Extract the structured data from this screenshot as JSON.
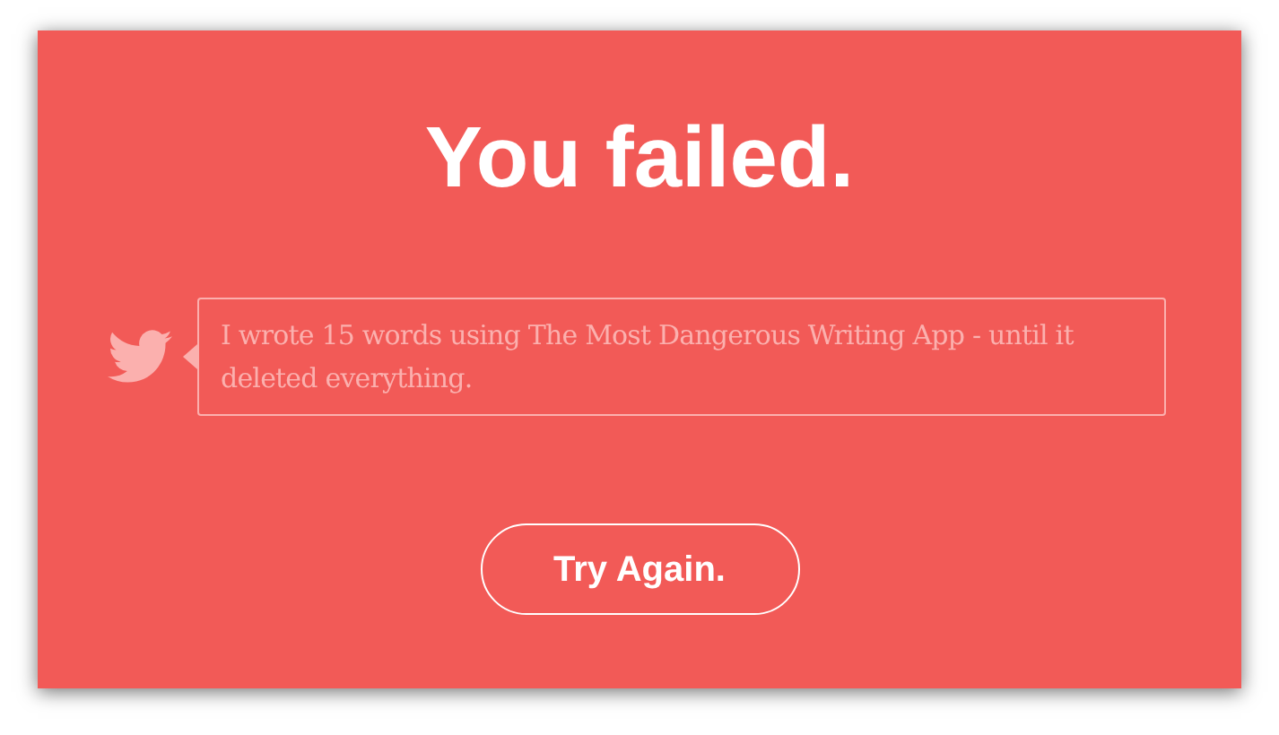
{
  "heading": "You failed.",
  "share_message": "I wrote 15 words using The Most Dangerous Writing App - until it deleted everything.",
  "button": "Try Again."
}
